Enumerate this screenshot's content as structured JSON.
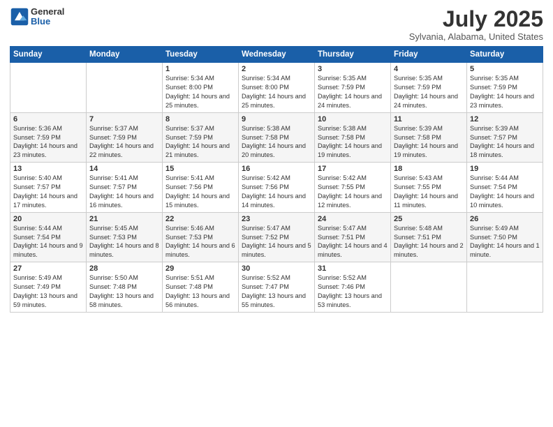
{
  "header": {
    "logo": {
      "line1": "General",
      "line2": "Blue"
    },
    "title": "July 2025",
    "subtitle": "Sylvania, Alabama, United States"
  },
  "calendar": {
    "weekdays": [
      "Sunday",
      "Monday",
      "Tuesday",
      "Wednesday",
      "Thursday",
      "Friday",
      "Saturday"
    ],
    "weeks": [
      [
        {
          "day": "",
          "info": ""
        },
        {
          "day": "",
          "info": ""
        },
        {
          "day": "1",
          "info": "Sunrise: 5:34 AM\nSunset: 8:00 PM\nDaylight: 14 hours and 25 minutes."
        },
        {
          "day": "2",
          "info": "Sunrise: 5:34 AM\nSunset: 8:00 PM\nDaylight: 14 hours and 25 minutes."
        },
        {
          "day": "3",
          "info": "Sunrise: 5:35 AM\nSunset: 7:59 PM\nDaylight: 14 hours and 24 minutes."
        },
        {
          "day": "4",
          "info": "Sunrise: 5:35 AM\nSunset: 7:59 PM\nDaylight: 14 hours and 24 minutes."
        },
        {
          "day": "5",
          "info": "Sunrise: 5:35 AM\nSunset: 7:59 PM\nDaylight: 14 hours and 23 minutes."
        }
      ],
      [
        {
          "day": "6",
          "info": "Sunrise: 5:36 AM\nSunset: 7:59 PM\nDaylight: 14 hours and 23 minutes."
        },
        {
          "day": "7",
          "info": "Sunrise: 5:37 AM\nSunset: 7:59 PM\nDaylight: 14 hours and 22 minutes."
        },
        {
          "day": "8",
          "info": "Sunrise: 5:37 AM\nSunset: 7:59 PM\nDaylight: 14 hours and 21 minutes."
        },
        {
          "day": "9",
          "info": "Sunrise: 5:38 AM\nSunset: 7:58 PM\nDaylight: 14 hours and 20 minutes."
        },
        {
          "day": "10",
          "info": "Sunrise: 5:38 AM\nSunset: 7:58 PM\nDaylight: 14 hours and 19 minutes."
        },
        {
          "day": "11",
          "info": "Sunrise: 5:39 AM\nSunset: 7:58 PM\nDaylight: 14 hours and 19 minutes."
        },
        {
          "day": "12",
          "info": "Sunrise: 5:39 AM\nSunset: 7:57 PM\nDaylight: 14 hours and 18 minutes."
        }
      ],
      [
        {
          "day": "13",
          "info": "Sunrise: 5:40 AM\nSunset: 7:57 PM\nDaylight: 14 hours and 17 minutes."
        },
        {
          "day": "14",
          "info": "Sunrise: 5:41 AM\nSunset: 7:57 PM\nDaylight: 14 hours and 16 minutes."
        },
        {
          "day": "15",
          "info": "Sunrise: 5:41 AM\nSunset: 7:56 PM\nDaylight: 14 hours and 15 minutes."
        },
        {
          "day": "16",
          "info": "Sunrise: 5:42 AM\nSunset: 7:56 PM\nDaylight: 14 hours and 14 minutes."
        },
        {
          "day": "17",
          "info": "Sunrise: 5:42 AM\nSunset: 7:55 PM\nDaylight: 14 hours and 12 minutes."
        },
        {
          "day": "18",
          "info": "Sunrise: 5:43 AM\nSunset: 7:55 PM\nDaylight: 14 hours and 11 minutes."
        },
        {
          "day": "19",
          "info": "Sunrise: 5:44 AM\nSunset: 7:54 PM\nDaylight: 14 hours and 10 minutes."
        }
      ],
      [
        {
          "day": "20",
          "info": "Sunrise: 5:44 AM\nSunset: 7:54 PM\nDaylight: 14 hours and 9 minutes."
        },
        {
          "day": "21",
          "info": "Sunrise: 5:45 AM\nSunset: 7:53 PM\nDaylight: 14 hours and 8 minutes."
        },
        {
          "day": "22",
          "info": "Sunrise: 5:46 AM\nSunset: 7:53 PM\nDaylight: 14 hours and 6 minutes."
        },
        {
          "day": "23",
          "info": "Sunrise: 5:47 AM\nSunset: 7:52 PM\nDaylight: 14 hours and 5 minutes."
        },
        {
          "day": "24",
          "info": "Sunrise: 5:47 AM\nSunset: 7:51 PM\nDaylight: 14 hours and 4 minutes."
        },
        {
          "day": "25",
          "info": "Sunrise: 5:48 AM\nSunset: 7:51 PM\nDaylight: 14 hours and 2 minutes."
        },
        {
          "day": "26",
          "info": "Sunrise: 5:49 AM\nSunset: 7:50 PM\nDaylight: 14 hours and 1 minute."
        }
      ],
      [
        {
          "day": "27",
          "info": "Sunrise: 5:49 AM\nSunset: 7:49 PM\nDaylight: 13 hours and 59 minutes."
        },
        {
          "day": "28",
          "info": "Sunrise: 5:50 AM\nSunset: 7:48 PM\nDaylight: 13 hours and 58 minutes."
        },
        {
          "day": "29",
          "info": "Sunrise: 5:51 AM\nSunset: 7:48 PM\nDaylight: 13 hours and 56 minutes."
        },
        {
          "day": "30",
          "info": "Sunrise: 5:52 AM\nSunset: 7:47 PM\nDaylight: 13 hours and 55 minutes."
        },
        {
          "day": "31",
          "info": "Sunrise: 5:52 AM\nSunset: 7:46 PM\nDaylight: 13 hours and 53 minutes."
        },
        {
          "day": "",
          "info": ""
        },
        {
          "day": "",
          "info": ""
        }
      ]
    ]
  }
}
